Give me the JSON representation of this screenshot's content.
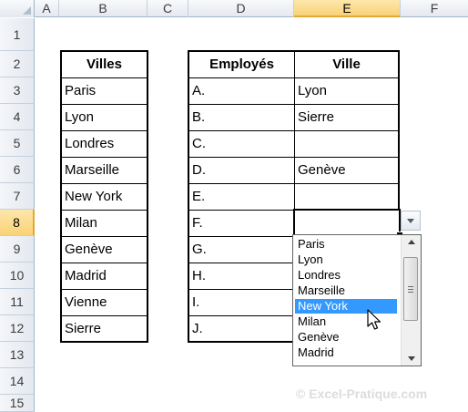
{
  "columns": [
    "A",
    "B",
    "C",
    "D",
    "E",
    "F"
  ],
  "rows": [
    "1",
    "2",
    "3",
    "4",
    "5",
    "6",
    "7",
    "8",
    "9",
    "10",
    "11",
    "12",
    "13",
    "14",
    "15"
  ],
  "villes_table": {
    "header": "Villes",
    "items": [
      "Paris",
      "Lyon",
      "Londres",
      "Marseille",
      "New York",
      "Milan",
      "Genève",
      "Madrid",
      "Vienne",
      "Sierre"
    ]
  },
  "employes_table": {
    "header_employes": "Employés",
    "header_ville": "Ville",
    "employes": [
      "A.",
      "B.",
      "C.",
      "D.",
      "E.",
      "F.",
      "G.",
      "H.",
      "I.",
      "J."
    ],
    "villes": [
      "Lyon",
      "Sierre",
      "",
      "Genève",
      "",
      "",
      "",
      "",
      "",
      ""
    ]
  },
  "dropdown": {
    "options": [
      "Paris",
      "Lyon",
      "Londres",
      "Marseille",
      "New York",
      "Milan",
      "Genève",
      "Madrid"
    ],
    "highlighted": "New York"
  },
  "watermark": "Excel-Pratique.com",
  "colors": {
    "highlight": "#3399ff",
    "selected_header": "#f9d277"
  }
}
